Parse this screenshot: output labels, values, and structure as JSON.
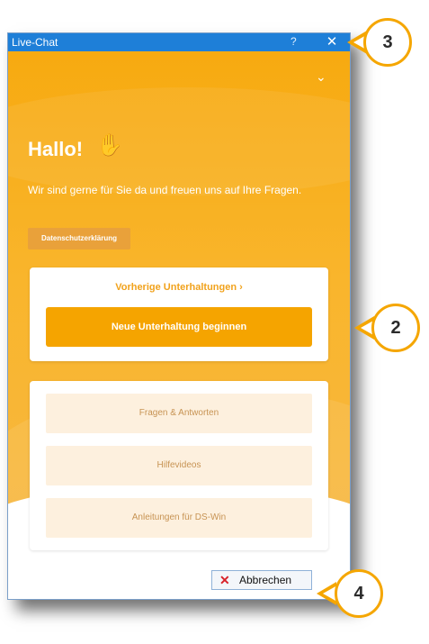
{
  "window": {
    "title": "Live-Chat",
    "help_glyph": "?",
    "close_glyph": "✕"
  },
  "chat": {
    "collapse_glyph": "⌄",
    "greeting": "Hallo!",
    "wave_emoji": "✋",
    "subtitle": "Wir sind gerne für Sie da und freuen uns auf Ihre Fragen.",
    "privacy_label": "Datenschutzerklärung",
    "previous_conversations": "Vorherige Unterhaltungen  ›",
    "new_conversation": "Neue Unterhaltung beginnen",
    "menu": [
      {
        "label": "Fragen & Antworten"
      },
      {
        "label": "Hilfevideos"
      },
      {
        "label": "Anleitungen für DS-Win"
      }
    ]
  },
  "footer": {
    "cancel_icon": "✕",
    "cancel_label": "Abbrechen"
  },
  "callouts": {
    "c2": "2",
    "c3": "3",
    "c4": "4"
  },
  "colors": {
    "accent": "#f5a400",
    "titlebar": "#1e7fd8",
    "cancel_x": "#d8222a"
  }
}
